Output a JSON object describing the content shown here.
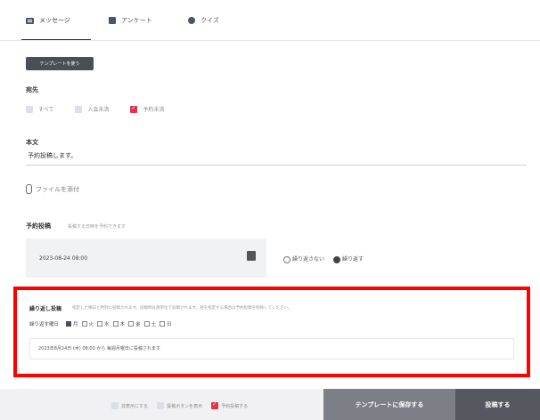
{
  "tabs": [
    {
      "label": "メッセージ",
      "icon": "message-icon",
      "active": true
    },
    {
      "label": "アンケート",
      "icon": "survey-icon",
      "active": false
    },
    {
      "label": "クイズ",
      "icon": "quiz-icon",
      "active": false
    }
  ],
  "template_button": "テンプレートを使う",
  "recipients": {
    "label": "宛先",
    "options": [
      {
        "label": "すべて",
        "checked": false
      },
      {
        "label": "入会未済",
        "checked": false
      },
      {
        "label": "予約未済",
        "checked": true
      }
    ]
  },
  "body": {
    "label": "本文",
    "value": "予約投稿します。"
  },
  "attach_label": "ファイルを添付",
  "schedule": {
    "label": "予約投稿",
    "hint": "投稿する日時を予約できます",
    "datetime": "2023-08-24 08:00",
    "options": [
      {
        "label": "繰り返さない",
        "selected": false
      },
      {
        "label": "繰り返す",
        "selected": true
      }
    ]
  },
  "repeat": {
    "label": "繰り返し投稿",
    "description": "指定した曜日と時刻に投稿されます。投稿時は週単位で投稿されます。週を指定する場合は予約投稿を削除してください。",
    "days_label": "繰り返す曜日",
    "days": [
      {
        "label": "月",
        "checked": true
      },
      {
        "label": "火",
        "checked": false
      },
      {
        "label": "水",
        "checked": false
      },
      {
        "label": "木",
        "checked": false
      },
      {
        "label": "金",
        "checked": false
      },
      {
        "label": "土",
        "checked": false
      },
      {
        "label": "日",
        "checked": false
      }
    ],
    "summary": "2023年8月24日 (木) 08:00 から 毎週月曜日に投稿されます"
  },
  "footer": {
    "options": [
      {
        "label": "非表示にする",
        "checked": false
      },
      {
        "label": "投稿ボタンを表示",
        "checked": false
      },
      {
        "label": "予約投稿する",
        "checked": true
      }
    ],
    "save_template": "テンプレートに保存する",
    "post": "投稿する"
  },
  "colors": {
    "accent_red": "#e0334d",
    "highlight_border": "#ff0000",
    "dark_button": "#55585f"
  }
}
